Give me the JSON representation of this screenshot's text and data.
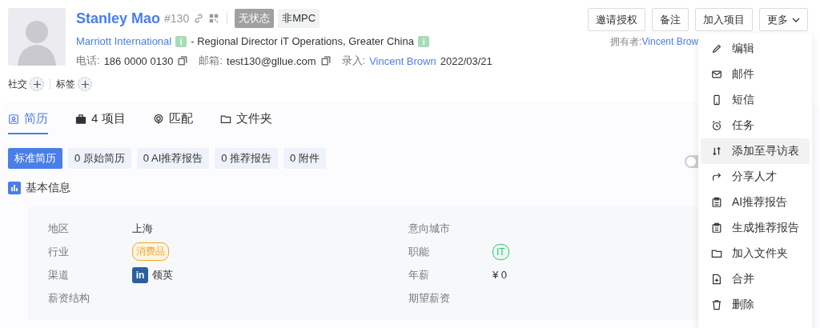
{
  "profile": {
    "name": "Stanley Mao",
    "number": "#130",
    "status_tags": [
      {
        "label": "无状态",
        "kind": "dark"
      },
      {
        "label": "非MPC",
        "kind": "light"
      }
    ],
    "company": "Marriott International",
    "title": "- Regional Director iT Operations, Greater China",
    "phone_label": "电话:",
    "phone": "186 0000 0130",
    "email_label": "邮箱:",
    "email": "test130@gllue.com",
    "entered_label": "录入:",
    "entered_by": "Vincent Brown",
    "entered_date": "2022/03/21",
    "social_label": "社交",
    "tags_label": "标签"
  },
  "actions": [
    {
      "label": "邀请授权"
    },
    {
      "label": "备注"
    },
    {
      "label": "加入项目"
    },
    {
      "label": "更多",
      "dropdown": true
    }
  ],
  "owner": {
    "label": "拥有者:",
    "name": "Vincent Brow"
  },
  "tabs": [
    {
      "label": "简历",
      "selected": true
    },
    {
      "label": "4 项目",
      "selected": false
    },
    {
      "label": "匹配",
      "selected": false
    },
    {
      "label": "文件夹",
      "selected": false
    }
  ],
  "resume_tabs": [
    {
      "label": "标准简历",
      "selected": true
    },
    {
      "label": "0 原始简历",
      "selected": false
    },
    {
      "label": "0 AI推荐报告",
      "selected": false
    },
    {
      "label": "0 推荐报告",
      "selected": false
    },
    {
      "label": "0 附件",
      "selected": false
    }
  ],
  "section_title": "基本信息",
  "toggle": {
    "on": false
  },
  "fields": [
    {
      "label": "地区",
      "value": "上海",
      "kind": "text"
    },
    {
      "label": "意向城市",
      "kind": "empty"
    },
    {
      "label": "行业",
      "value": "消费品",
      "kind": "tag",
      "color": "#f5a623"
    },
    {
      "label": "职能",
      "value": "IT",
      "kind": "tag",
      "color": "#3cc27a"
    },
    {
      "label": "渠道",
      "value": "领英",
      "kind": "source",
      "logo": "in"
    },
    {
      "label": "年薪",
      "value": "¥ 0",
      "kind": "text"
    },
    {
      "label": "薪资结构",
      "kind": "empty"
    },
    {
      "label": "期望薪资",
      "kind": "empty"
    }
  ],
  "menu": [
    {
      "label": "编辑",
      "selected": false
    },
    {
      "label": "邮件",
      "selected": false
    },
    {
      "label": "短信",
      "selected": false
    },
    {
      "label": "任务",
      "selected": false
    },
    {
      "label": "添加至寻访表",
      "selected": true
    },
    {
      "label": "分享人才",
      "selected": false
    },
    {
      "label": "AI推荐报告",
      "selected": false
    },
    {
      "label": "生成推荐报告",
      "selected": false
    },
    {
      "label": "加入文件夹",
      "selected": false
    },
    {
      "label": "合并",
      "selected": false
    },
    {
      "label": "删除",
      "selected": false
    }
  ]
}
